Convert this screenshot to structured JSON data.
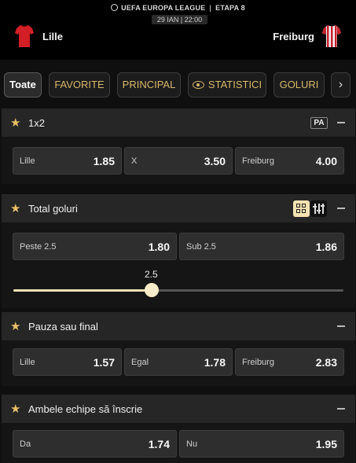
{
  "header": {
    "competition": "UEFA EUROPA LEAGUE",
    "stage": "ETAPA  8",
    "date": "29 IAN | 22:00",
    "home_team": "Lille",
    "away_team": "Freiburg"
  },
  "tabs": [
    {
      "label": "Toate",
      "active": true
    },
    {
      "label": "FAVORITE",
      "active": false
    },
    {
      "label": "PRINCIPAL",
      "active": false
    },
    {
      "label": "STATISTICI",
      "active": false,
      "icon": "eye-icon"
    },
    {
      "label": "GOLURI",
      "active": false
    },
    {
      "label": "›",
      "active": false,
      "icon": "chevron-right-icon"
    }
  ],
  "sections": {
    "s1x2": {
      "title": "1x2",
      "badge": "PA",
      "odds": [
        {
          "label": "Lille",
          "value": "1.85"
        },
        {
          "label": "X",
          "value": "3.50"
        },
        {
          "label": "Freiburg",
          "value": "4.00"
        }
      ]
    },
    "total": {
      "title": "Total goluri",
      "odds": [
        {
          "label": "Peste 2.5",
          "value": "1.80"
        },
        {
          "label": "Sub 2.5",
          "value": "1.86"
        }
      ],
      "slider_value": "2.5",
      "slider_fraction": 0.42
    },
    "pauza": {
      "title": "Pauza sau final",
      "odds": [
        {
          "label": "Lille",
          "value": "1.57"
        },
        {
          "label": "Egal",
          "value": "1.78"
        },
        {
          "label": "Freiburg",
          "value": "2.83"
        }
      ]
    },
    "ambele": {
      "title": "Ambele echipe să înscrie",
      "odds": [
        {
          "label": "Da",
          "value": "1.74"
        },
        {
          "label": "Nu",
          "value": "1.95"
        }
      ]
    }
  },
  "colors": {
    "accent": "#d8b86a",
    "star": "#e6c065",
    "slider": "#f3e2b4",
    "home_shirt": "#d21f25",
    "away_shirt_stripe": "#c8202e"
  }
}
